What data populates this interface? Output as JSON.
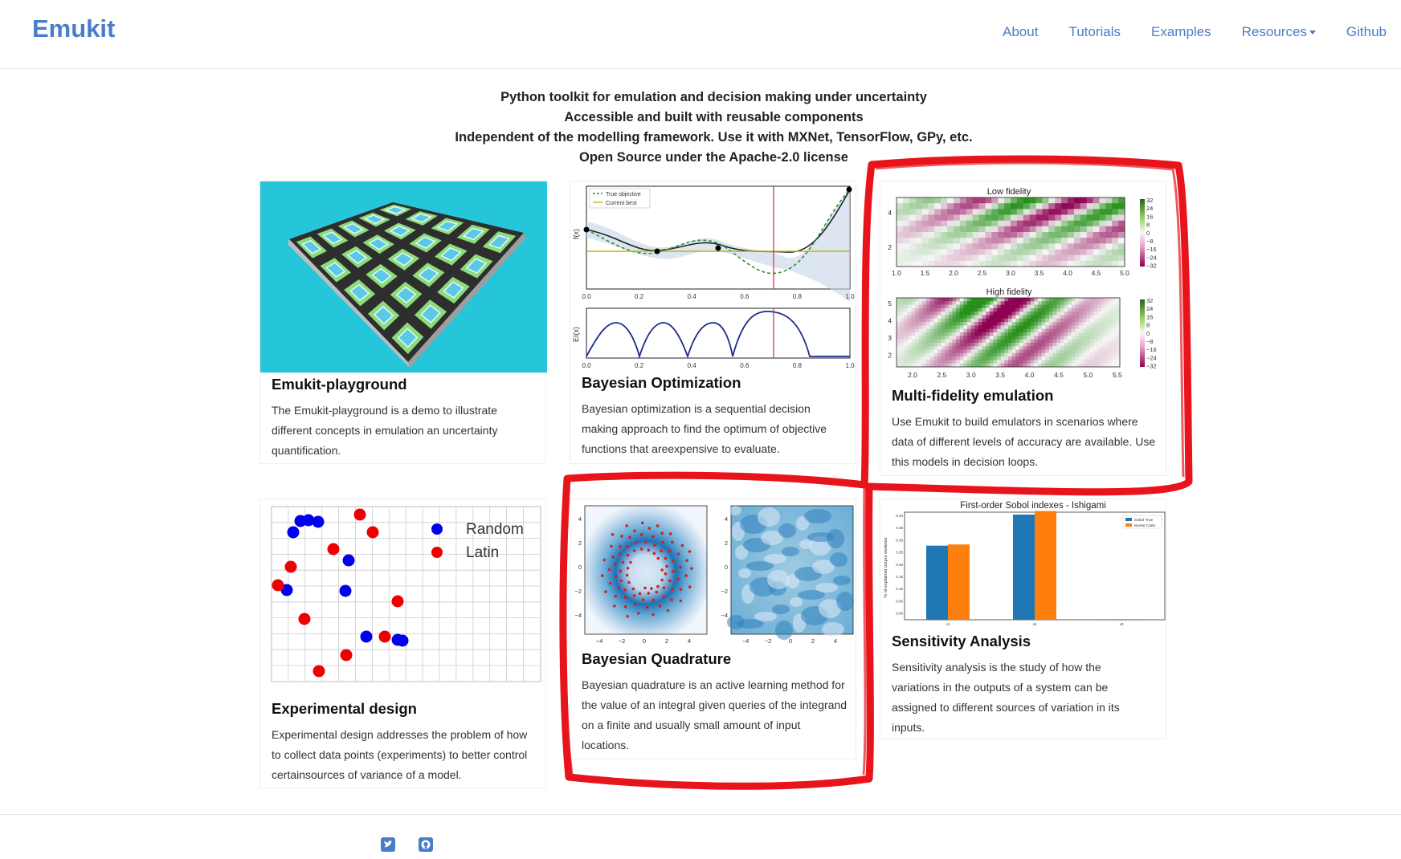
{
  "brand": "Emukit",
  "nav": {
    "about": "About",
    "tutorials": "Tutorials",
    "examples": "Examples",
    "resources": "Resources",
    "github": "Github"
  },
  "intro": [
    "Python toolkit for emulation and decision making under uncertainty",
    "Accessible and built with reusable components",
    "Independent of the modelling framework. Use it with MXNet, TensorFlow, GPy, etc.",
    "Open Source under the Apache-2.0 license"
  ],
  "cards": {
    "playground": {
      "title": "Emukit-playground",
      "text": "The Emukit-playground is a demo to illustrate different concepts in emulation an uncertainty quantification."
    },
    "bayesopt": {
      "title": "Bayesian Optimization",
      "text": "Bayesian optimization is a sequential decision making approach to find the optimum of objective functions that areexpensive to evaluate.",
      "legend_true": "True objective",
      "legend_best": "Current best",
      "ylabel_top": "f(x)",
      "ylabel_bottom": "EI(x)",
      "xticks": [
        "0.0",
        "0.2",
        "0.4",
        "0.6",
        "0.8",
        "1.0"
      ]
    },
    "multifidelity": {
      "title": "Multi-fidelity emulation",
      "text": "Use Emukit to build emulators in scenarios where data of different levels of accuracy are available. Use this models in decision loops.",
      "low_title": "Low fidelity",
      "high_title": "High fidelity",
      "low_xticks": [
        "1.0",
        "1.5",
        "2.0",
        "2.5",
        "3.0",
        "3.5",
        "4.0",
        "4.5",
        "5.0"
      ],
      "high_xticks": [
        "2.0",
        "2.5",
        "3.0",
        "3.5",
        "4.0",
        "4.5",
        "5.0",
        "5.5"
      ],
      "low_yticks": [
        "4",
        "2"
      ],
      "high_yticks": [
        "5",
        "4",
        "3",
        "2"
      ],
      "colorbar_ticks": [
        "32",
        "24",
        "16",
        "8",
        "0",
        "−8",
        "−16",
        "−24",
        "−32"
      ]
    },
    "expdesign": {
      "title": "Experimental design",
      "text": "Experimental design addresses the problem of how to collect data points (experiments) to better control certainsources of variance of a model.",
      "legend_random": "Random",
      "legend_latin": "Latin"
    },
    "quadrature": {
      "title": "Bayesian Quadrature",
      "text": "Bayesian quadrature is an active learning method for the value of an integral given queries of the integrand on a finite and usually small amount of input locations.",
      "yticks": [
        "4",
        "2",
        "0",
        "−2",
        "−4"
      ],
      "xticks": [
        "−4",
        "−2",
        "0",
        "2",
        "4"
      ]
    },
    "sensitivity": {
      "title": "Sensitivity Analysis",
      "text": "Sensitivity analysis is the study of how the variations in the outputs of a system can be assigned to different sources of variation in its inputs.",
      "chart_title": "First-order Sobol indexes - Ishigami",
      "ylabel": "% of explained output variance",
      "legend_true": "Sobol True",
      "legend_mc": "Monte Carlo",
      "yticks": [
        "0.40",
        "0.35",
        "0.30",
        "0.25",
        "0.20",
        "0.15",
        "0.10",
        "0.05",
        "0.00"
      ],
      "xticks": [
        "x1",
        "x2",
        "x3"
      ]
    }
  },
  "colors": {
    "brand": "#4a7dc9",
    "highlight": "#e8141c",
    "sobol_true": "#1f77b4",
    "monte_carlo": "#ff7f0e",
    "random": "#0000ee",
    "latin": "#ee0000",
    "playground_bg": "#26c6da"
  },
  "footer": {
    "icons": [
      "twitter-icon",
      "github-icon"
    ]
  },
  "chart_data": [
    {
      "type": "bar",
      "title": "First-order Sobol indexes - Ishigami",
      "ylabel": "% of explained output variance",
      "categories": [
        "x1",
        "x2",
        "x3"
      ],
      "series": [
        {
          "name": "Sobol True",
          "values": [
            0.31,
            0.44,
            0.0
          ]
        },
        {
          "name": "Monte Carlo",
          "values": [
            0.315,
            0.455,
            0.003
          ]
        }
      ],
      "ylim": [
        0,
        0.4
      ],
      "legend": "top-right"
    }
  ]
}
